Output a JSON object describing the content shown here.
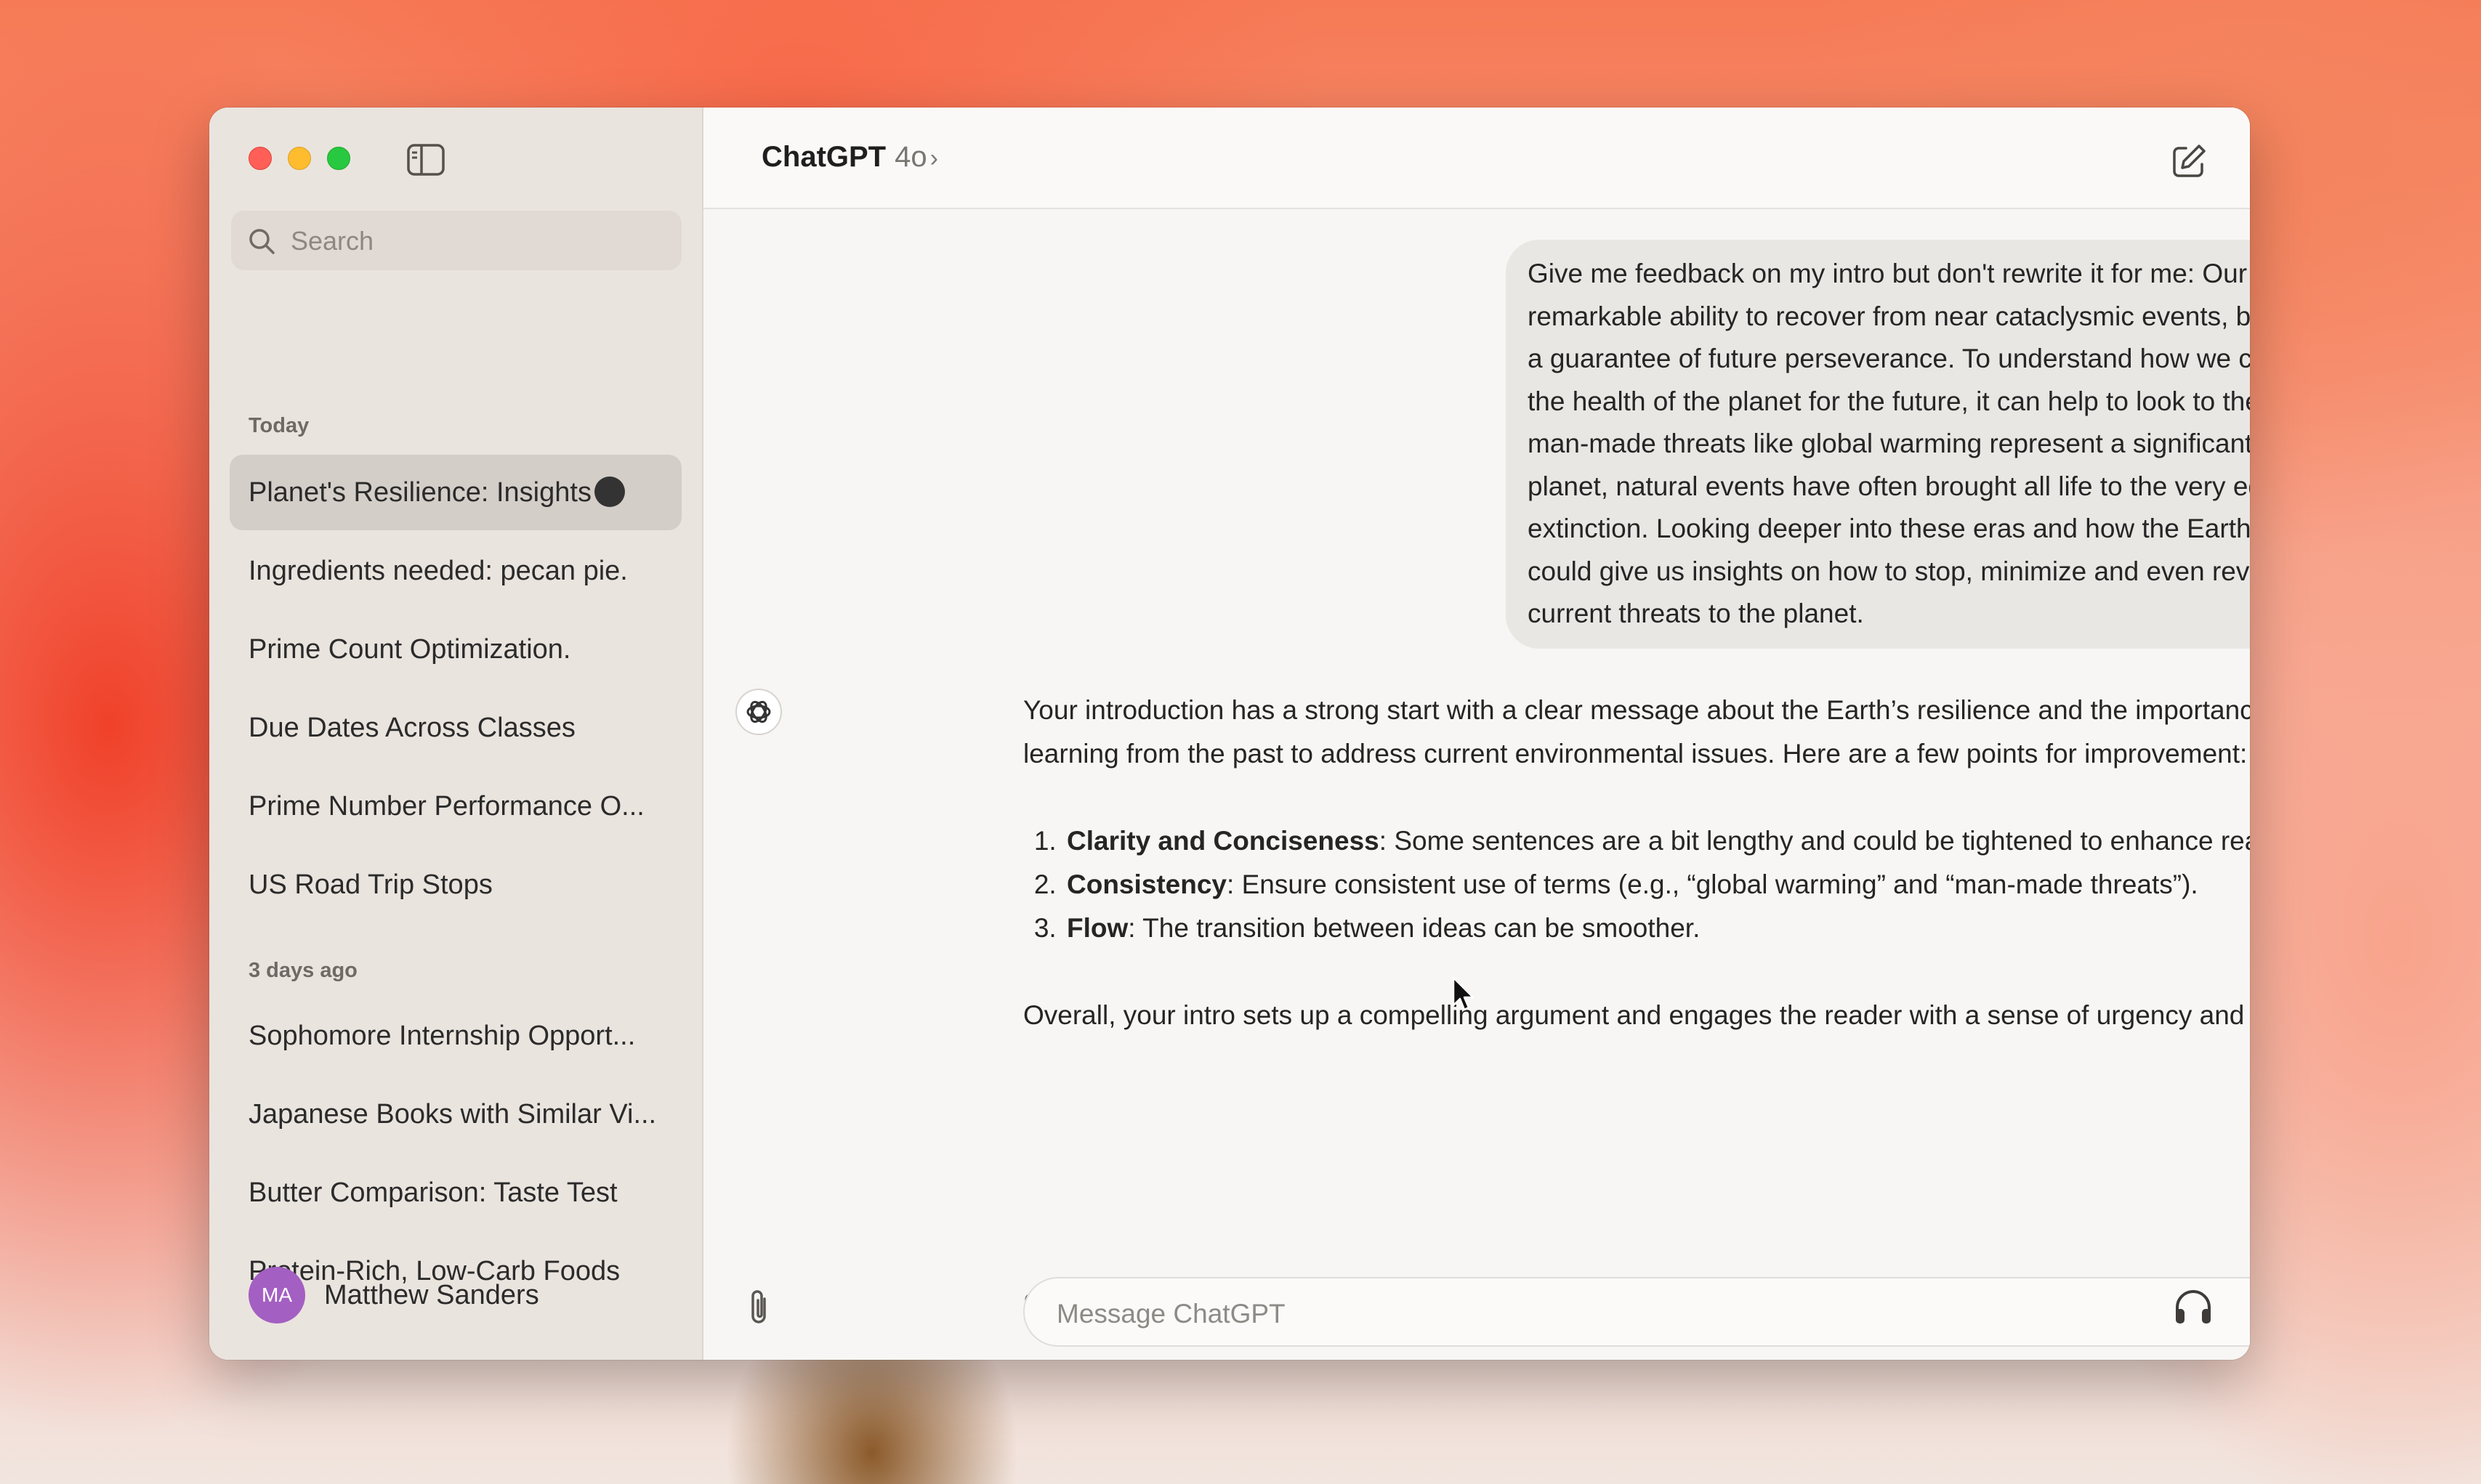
{
  "sidebar": {
    "search_placeholder": "Search",
    "today_label": "Today",
    "today_items": [
      "Planet's Resilience: Insights",
      "Ingredients needed: pecan pie.",
      "Prime Count Optimization.",
      "Due Dates Across Classes",
      "Prime Number Performance O...",
      "US Road Trip Stops"
    ],
    "older_label": "3 days ago",
    "older_items": [
      "Sophomore Internship Opport...",
      "Japanese Books with Similar Vi...",
      "Butter Comparison: Taste Test",
      "Protein-Rich, Low-Carb Foods"
    ],
    "user": {
      "initials": "MA",
      "name": "Matthew Sanders"
    }
  },
  "header": {
    "title": "ChatGPT",
    "model": "4o",
    "chevron": "›"
  },
  "conversation": {
    "user_message": "Give me feedback on my intro but don't rewrite it for me: Our planet has a remarkable ability to recover from near cataclysmic events, but this is not a guarantee of future perseverance. To understand how we can ensure the health of the planet for the future, it can help to look to the past. While man-made threats like global warming represent a significant threat to the planet, natural events have often brought all life to the very edge of extinction. Looking deeper into these eras and how the Earth recovered, could give us insights on how to stop, minimize and even reverse the current threats to the planet.",
    "assistant_intro": "Your introduction has a strong start with a clear message about the Earth’s resilience and the importance of learning from the past to address current environmental issues. Here are a few points for improvement:",
    "points": [
      {
        "title": "Clarity and Conciseness",
        "text": ": Some sentences are a bit lengthy and could be tightened to enhance readability."
      },
      {
        "title": "Consistency",
        "text": ": Ensure consistent use of terms (e.g., “global warming” and “man-made threats”)."
      },
      {
        "title": "Flow",
        "text": ": The transition between ideas can be smoother."
      }
    ],
    "assistant_outro": "Overall, your intro sets up a compelling argument and engages the reader with a sense of urgency and purpose."
  },
  "composer": {
    "placeholder": "Message ChatGPT"
  },
  "colors": {
    "avatar": "#a35fc2",
    "close": "#ff5f57",
    "minimize": "#febc2e",
    "zoom": "#28c840"
  }
}
